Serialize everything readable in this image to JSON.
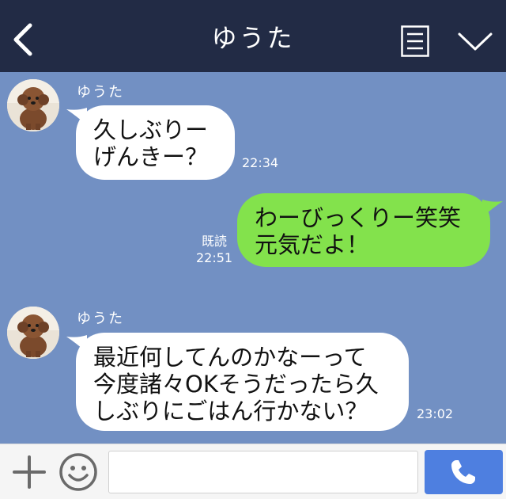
{
  "header": {
    "title": "ゆうた",
    "back_icon": "chevron-left-icon",
    "menu_icon": "menu-icon",
    "down_icon": "chevron-down-icon",
    "background": "#222b45"
  },
  "chat": {
    "background": "#7290c3",
    "messages": [
      {
        "direction": "incoming",
        "sender": "ゆうた",
        "text": "久しぶりー\nげんきー？",
        "time": "22:34"
      },
      {
        "direction": "outgoing",
        "text": "わーびっくりー笑笑\n元気だよ！",
        "read": "既読",
        "time": "22:51"
      },
      {
        "direction": "incoming",
        "sender": "ゆうた",
        "text": "最近何してんのかなーって\n今度諸々OKそうだったら久\nしぶりにごはん行かない？",
        "time": "23:02"
      }
    ],
    "incoming_bubble_color": "#ffffff",
    "outgoing_bubble_color": "#83e24c"
  },
  "footer": {
    "plus_icon": "plus-icon",
    "sticker_icon": "smiley-icon",
    "input_value": "",
    "call_icon": "phone-icon",
    "call_color": "#4e7fe0"
  }
}
